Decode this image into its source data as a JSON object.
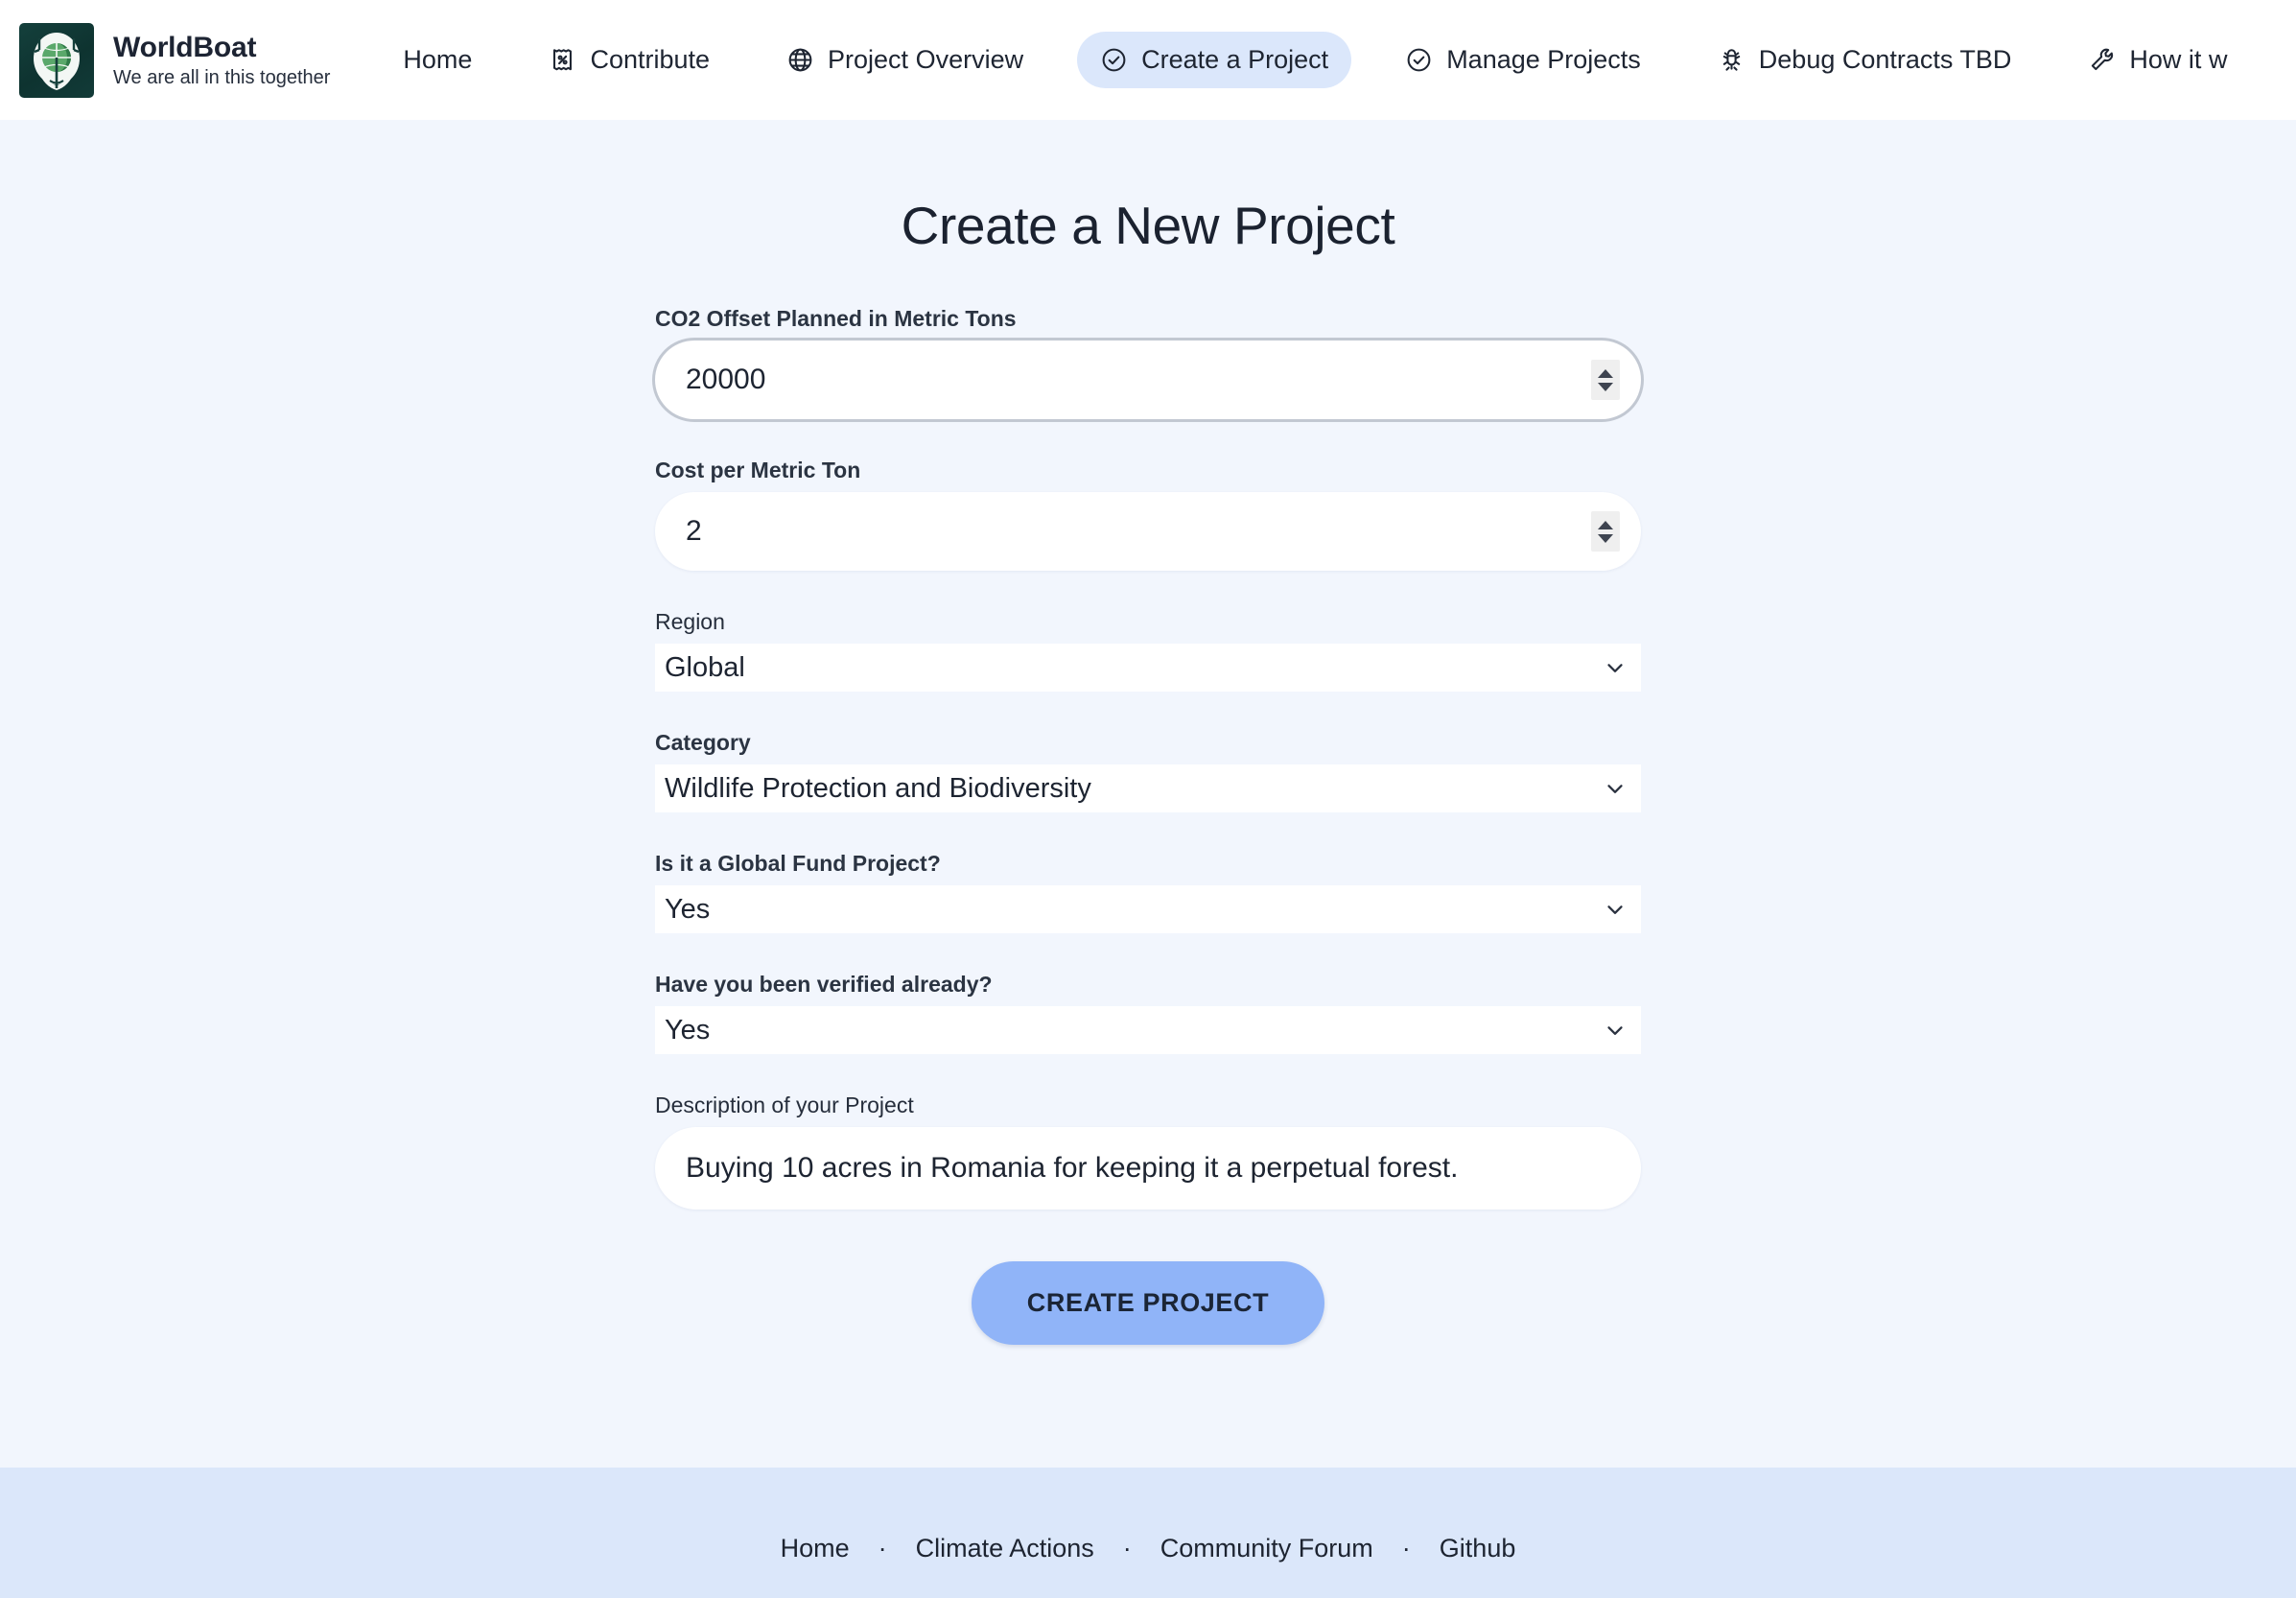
{
  "brand": {
    "name": "WorldBoat",
    "tagline": "We are all in this together",
    "logo_icon": "globe-emblem-logo",
    "logo_bg": "#123b38"
  },
  "nav": {
    "active_bg": "#dbe7fb",
    "items": [
      {
        "label": "Home",
        "icon": "",
        "active": false
      },
      {
        "label": "Contribute",
        "icon": "receipt-percent-icon",
        "active": false
      },
      {
        "label": "Project Overview",
        "icon": "globe-icon",
        "active": false
      },
      {
        "label": "Create a Project",
        "icon": "check-circle-icon",
        "active": true
      },
      {
        "label": "Manage Projects",
        "icon": "check-circle-icon",
        "active": false
      },
      {
        "label": "Debug Contracts TBD",
        "icon": "bug-icon",
        "active": false
      },
      {
        "label": "How it w",
        "icon": "wrench-icon",
        "active": false
      }
    ]
  },
  "main": {
    "title": "Create a New Project",
    "fields": {
      "co2_offset": {
        "label": "CO2 Offset Planned in Metric Tons",
        "value": "20000",
        "placeholder": "",
        "focused": true
      },
      "cost_per_ton": {
        "label": "Cost per Metric Ton",
        "value": "2",
        "placeholder": "",
        "focused": false
      },
      "region": {
        "label": "Region",
        "value": "Global"
      },
      "category": {
        "label": "Category",
        "value": "Wildlife Protection and Biodiversity"
      },
      "global_fund": {
        "label": "Is it a Global Fund Project?",
        "value": "Yes"
      },
      "verified": {
        "label": "Have you been verified already?",
        "value": "Yes"
      },
      "description": {
        "label": "Description of your Project",
        "value": "Buying 10 acres in Romania for keeping it a perpetual forest.",
        "placeholder": ""
      }
    },
    "submit_label": "CREATE PROJECT",
    "submit_color": "#90b4f8"
  },
  "footer": {
    "bg": "#dbe7fa",
    "separator": "·",
    "links": [
      {
        "label": "Home"
      },
      {
        "label": "Climate Actions"
      },
      {
        "label": "Community Forum"
      },
      {
        "label": "Github"
      }
    ]
  }
}
